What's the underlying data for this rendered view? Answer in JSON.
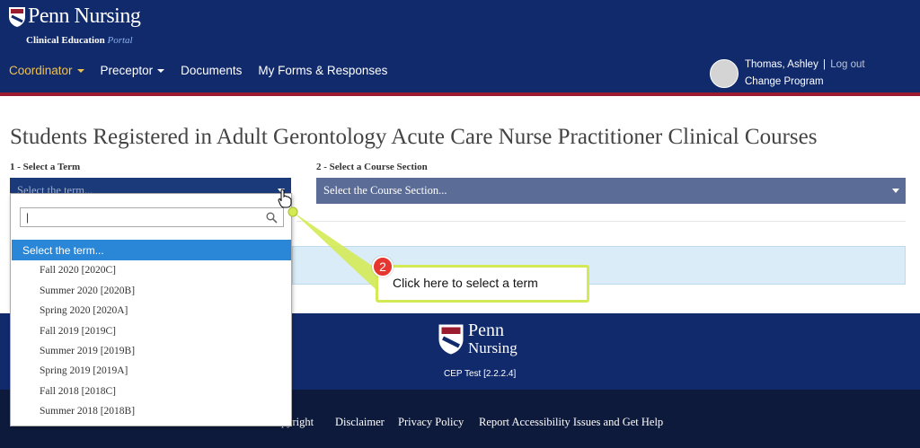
{
  "header": {
    "brand_name": "Penn Nursing",
    "brand_sub_main": "Clinical Education ",
    "brand_sub_portal": "Portal",
    "nav": [
      {
        "label": "Coordinator",
        "has_caret": true,
        "active": true
      },
      {
        "label": "Preceptor",
        "has_caret": true,
        "active": false
      },
      {
        "label": "Documents",
        "has_caret": false,
        "active": false
      },
      {
        "label": "My Forms & Responses",
        "has_caret": false,
        "active": false
      }
    ],
    "user": {
      "name": "Thomas, Ashley",
      "separator": "|",
      "logout": "Log out",
      "change_program": "Change Program"
    }
  },
  "main": {
    "title": "Students Registered in Adult Gerontology Acute Care Nurse Practitioner Clinical Courses",
    "term_label": "1 - Select a Term",
    "term_placeholder": "Select the term...",
    "course_label": "2 - Select a Course Section",
    "course_placeholder": "Select the Course Section..."
  },
  "dropdown": {
    "search_value": "|",
    "selected_option": "Select the term...",
    "options": [
      "Fall 2020 [2020C]",
      "Summer 2020 [2020B]",
      "Spring 2020 [2020A]",
      "Fall 2019 [2019C]",
      "Summer 2019 [2019B]",
      "Spring 2019 [2019A]",
      "Fall 2018 [2018C]",
      "Summer 2018 [2018B]"
    ]
  },
  "callout": {
    "badge": "2",
    "text": "Click here to select a term"
  },
  "footer": {
    "logo_penn": "Penn",
    "logo_nursing": "Nursing",
    "version": "CEP Test [2.2.2.4]",
    "links": [
      "pyright",
      "Disclaimer",
      "Privacy Policy",
      "Report Accessibility Issues and Get Help"
    ]
  },
  "colors": {
    "header_bg": "#112a6b",
    "header_accent": "#9b1c2e",
    "nav_active": "#f2c14e",
    "select_active": "#2a87d8",
    "callout_border": "#d4ea55",
    "badge": "#e5372f"
  }
}
